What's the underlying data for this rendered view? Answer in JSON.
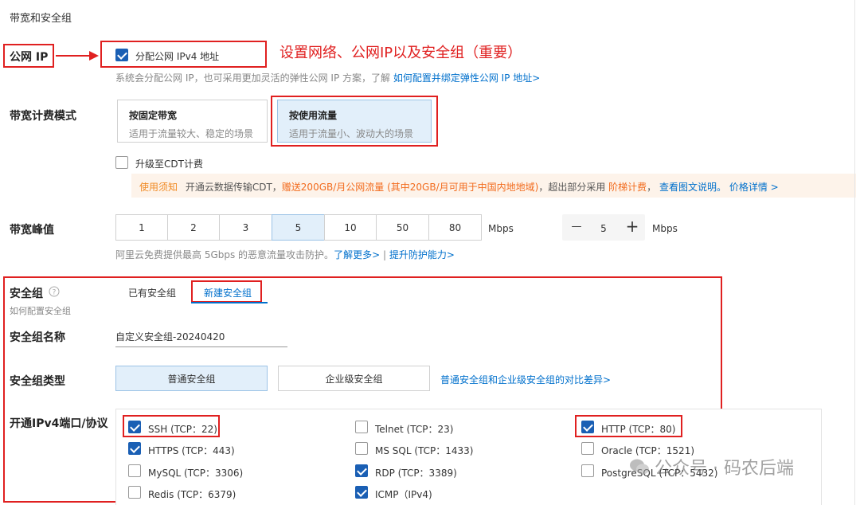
{
  "header": {
    "title": "带宽和安全组"
  },
  "annotation": {
    "note": "设置网络、公网IP以及安全组（重要）"
  },
  "public_ip": {
    "label": "公网 IP",
    "checkbox_label": "分配公网 IPv4 地址",
    "checked": true,
    "hint_text": "系统会分配公网 IP，也可采用更加灵活的弹性公网 IP 方案，了解",
    "hint_link": "如何配置并绑定弹性公网 IP 地址>"
  },
  "billing": {
    "label": "带宽计费模式",
    "options": [
      {
        "title": "按固定带宽",
        "desc": "适用于流量较大、稳定的场景",
        "selected": false
      },
      {
        "title": "按使用流量",
        "desc": "适用于流量小、波动大的场景",
        "selected": true
      }
    ],
    "cdt_label": "升级至CDT计费",
    "notice": {
      "tag": "使用须知",
      "text1": "开通云数据传输CDT，",
      "highlight": "赠送200GB/月公网流量 (其中20GB/月可用于中国内地地域)",
      "text2": "，超出部分采用",
      "tier": "阶梯计费",
      "text3": "，",
      "link1": "查看图文说明。",
      "link2": "价格详情 >"
    }
  },
  "bandwidth": {
    "label": "带宽峰值",
    "options": [
      "1",
      "2",
      "3",
      "5",
      "10",
      "50",
      "80"
    ],
    "selected": "5",
    "unit": "Mbps",
    "stepper_minus": "—",
    "stepper_value": "5",
    "stepper_plus": "+",
    "stepper_unit": "Mbps",
    "hint_text": "阿里云免费提供最高 5Gbps 的恶意流量攻击防护。",
    "hint_link1": "了解更多>",
    "hint_sep": "|",
    "hint_link2": "提升防护能力>"
  },
  "security_group": {
    "label": "安全组",
    "help_icon": "question-circle-icon",
    "sub_label": "如何配置安全组",
    "tabs": [
      {
        "label": "已有安全组",
        "active": false
      },
      {
        "label": "新建安全组",
        "active": true
      }
    ],
    "name_label": "安全组名称",
    "name_value": "自定义安全组-20240420",
    "type_label": "安全组类型",
    "types": [
      {
        "label": "普通安全组",
        "selected": true
      },
      {
        "label": "企业级安全组",
        "selected": false
      }
    ],
    "type_link": "普通安全组和企业级安全组的对比差异>",
    "ports_label": "开通IPv4端口/协议",
    "ports": [
      {
        "label": "SSH (TCP：22)",
        "checked": true
      },
      {
        "label": "Telnet (TCP：23)",
        "checked": false
      },
      {
        "label": "HTTP (TCP：80)",
        "checked": true
      },
      {
        "label": "HTTPS (TCP：443)",
        "checked": true
      },
      {
        "label": "MS SQL (TCP：1433)",
        "checked": false
      },
      {
        "label": "Oracle (TCP：1521)",
        "checked": false
      },
      {
        "label": "MySQL (TCP：3306)",
        "checked": false
      },
      {
        "label": "RDP (TCP：3389)",
        "checked": true
      },
      {
        "label": "PostgreSQL (TCP：5432)",
        "checked": false
      },
      {
        "label": "Redis (TCP：6379)",
        "checked": false
      },
      {
        "label": "ICMP（IPv4)",
        "checked": true
      }
    ]
  },
  "watermark": {
    "text": "公众号 · 码农后端"
  }
}
